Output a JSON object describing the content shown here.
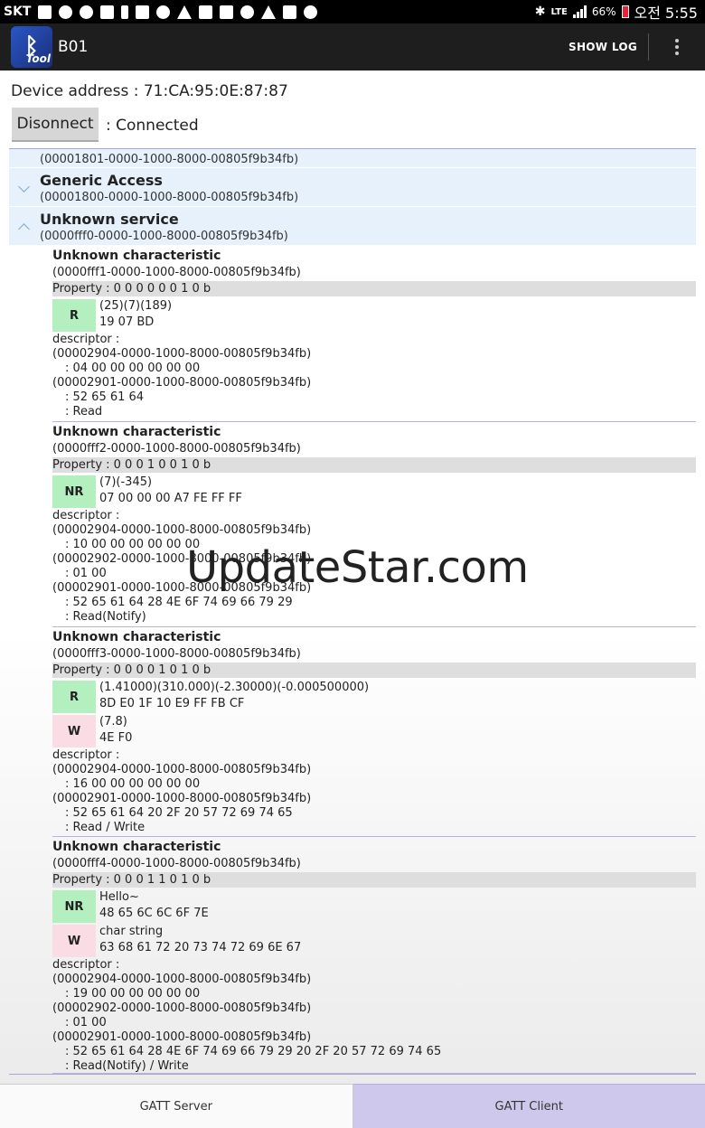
{
  "status_bar": {
    "carrier": "SKT",
    "network": "LTE",
    "battery": "66%",
    "time": "오전 5:55",
    "icons": [
      "s-icon",
      "game-icon",
      "signal-circle-icon",
      "shield-icon",
      "key-icon",
      "image-icon",
      "sync-icon",
      "warning-icon",
      "mail-icon",
      "gallery-icon",
      "news-icon",
      "warning-icon",
      "mail-icon",
      "app-icon"
    ]
  },
  "action_bar": {
    "app_icon_label": "Tool",
    "title": "B01",
    "show_log": "SHOW LOG"
  },
  "device": {
    "address": "Device address : 71:CA:95:0E:87:87",
    "disconnect": "Disonnect",
    "status": ": Connected"
  },
  "services": [
    {
      "name": "",
      "uuid": "(00001801-0000-1000-8000-00805f9b34fb)",
      "expanded": false
    },
    {
      "name": "Generic Access",
      "uuid": "(00001800-0000-1000-8000-00805f9b34fb)",
      "expanded": false
    },
    {
      "name": "Unknown service",
      "uuid": "(0000fff0-0000-1000-8000-00805f9b34fb)",
      "expanded": true
    }
  ],
  "characteristics": [
    {
      "name": "Unknown characteristic",
      "uuid": "(0000fff1-0000-1000-8000-00805f9b34fb)",
      "property": "Property :  0 0 0 0 0 0 1 0 b",
      "values": [
        {
          "type": "R",
          "decoded": "(25)(7)(189)",
          "hex": "19 07 BD"
        }
      ],
      "descriptor_label": "descriptor :",
      "descriptors": [
        "(00002904-0000-1000-8000-00805f9b34fb)",
        ": 04 00 00 00 00 00 00",
        "(00002901-0000-1000-8000-00805f9b34fb)",
        ": 52 65 61 64",
        ": Read"
      ]
    },
    {
      "name": "Unknown characteristic",
      "uuid": "(0000fff2-0000-1000-8000-00805f9b34fb)",
      "property": "Property :  0 0 0 1 0 0 1 0 b",
      "values": [
        {
          "type": "NR",
          "decoded": "(7)(-345)",
          "hex": "07 00 00 00 A7 FE FF FF"
        }
      ],
      "descriptor_label": "descriptor :",
      "descriptors": [
        "(00002904-0000-1000-8000-00805f9b34fb)",
        ": 10 00 00 00 00 00 00",
        "(00002902-0000-1000-8000-00805f9b34fb)",
        ": 01 00",
        "(00002901-0000-1000-8000-00805f9b34fb)",
        ": 52 65 61 64 28 4E 6F 74 69 66 79 29",
        ": Read(Notify)"
      ]
    },
    {
      "name": "Unknown characteristic",
      "uuid": "(0000fff3-0000-1000-8000-00805f9b34fb)",
      "property": "Property :  0 0 0 0 1 0 1 0 b",
      "values": [
        {
          "type": "R",
          "decoded": "(1.41000)(310.000)(-2.30000)(-0.000500000)",
          "hex": "8D E0 1F 10 E9 FF FB CF"
        },
        {
          "type": "W",
          "decoded": "(7.8)",
          "hex": "4E F0"
        }
      ],
      "descriptor_label": "descriptor :",
      "descriptors": [
        "(00002904-0000-1000-8000-00805f9b34fb)",
        ": 16 00 00 00 00 00 00",
        "(00002901-0000-1000-8000-00805f9b34fb)",
        ": 52 65 61 64 20 2F 20 57 72 69 74 65",
        ": Read / Write"
      ]
    },
    {
      "name": "Unknown characteristic",
      "uuid": "(0000fff4-0000-1000-8000-00805f9b34fb)",
      "property": "Property :  0 0 0 1 1 0 1 0 b",
      "values": [
        {
          "type": "NR",
          "decoded": "Hello~",
          "hex": "48 65 6C 6C 6F 7E"
        },
        {
          "type": "W",
          "decoded": "char string",
          "hex": "63 68 61 72 20 73 74 72 69 6E 67"
        }
      ],
      "descriptor_label": "descriptor :",
      "descriptors": [
        "(00002904-0000-1000-8000-00805f9b34fb)",
        ": 19 00 00 00 00 00 00",
        "(00002902-0000-1000-8000-00805f9b34fb)",
        ": 01 00",
        "(00002901-0000-1000-8000-00805f9b34fb)",
        ": 52 65 61 64 28 4E 6F 74 69 66 79 29 20 2F 20 57 72 69 74 65",
        ": Read(Notify) / Write"
      ]
    }
  ],
  "watermark": "UpdateStar.com",
  "tabs": {
    "server": "GATT Server",
    "client": "GATT Client",
    "selected": "GATT Client"
  }
}
